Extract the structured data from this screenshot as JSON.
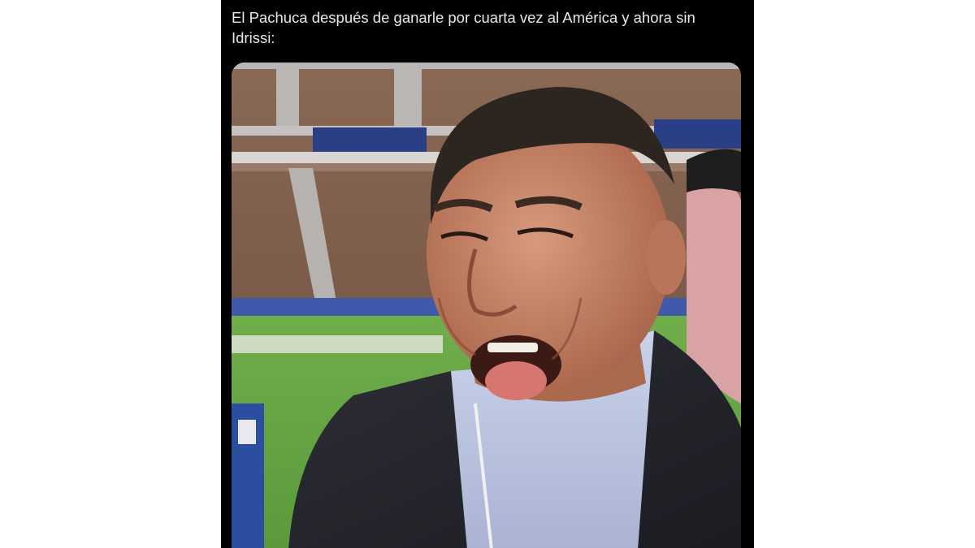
{
  "post": {
    "text": "El Pachuca después de ganarle por cuarta vez al América y ahora sin Idrissi:"
  },
  "media": {
    "kind": "photo"
  },
  "colors": {
    "background": "#ffffff",
    "post_background": "#000000",
    "text": "#e7e9ea"
  }
}
